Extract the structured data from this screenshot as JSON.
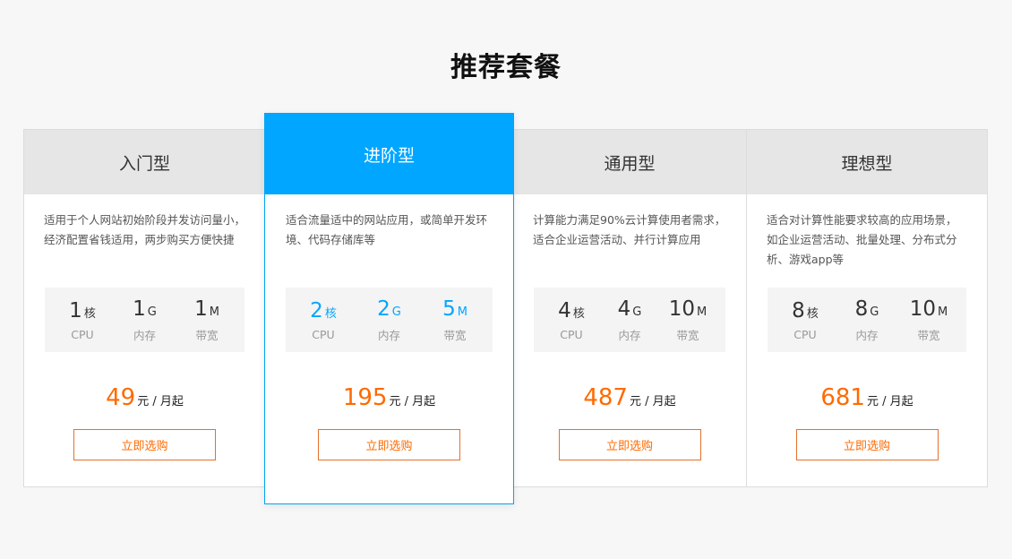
{
  "section_title": "推荐套餐",
  "plans": [
    {
      "name": "入门型",
      "desc": "适用于个人网站初始阶段并发访问量小，经济配置省钱适用，两步购买方便快捷",
      "specs": [
        {
          "num": "1",
          "unit": "核",
          "label": "CPU"
        },
        {
          "num": "1",
          "unit": "G",
          "label": "内存"
        },
        {
          "num": "1",
          "unit": "M",
          "label": "带宽"
        }
      ],
      "price": "49",
      "price_suffix": "元 / 月起",
      "buy_label": "立即选购"
    },
    {
      "name": "进阶型",
      "desc": "适合流量适中的网站应用，或简单开发环境、代码存储库等",
      "specs": [
        {
          "num": "2",
          "unit": "核",
          "label": "CPU"
        },
        {
          "num": "2",
          "unit": "G",
          "label": "内存"
        },
        {
          "num": "5",
          "unit": "M",
          "label": "带宽"
        }
      ],
      "price": "195",
      "price_suffix": "元 / 月起",
      "buy_label": "立即选购"
    },
    {
      "name": "通用型",
      "desc": "计算能力满足90%云计算使用者需求，适合企业运营活动、并行计算应用",
      "specs": [
        {
          "num": "4",
          "unit": "核",
          "label": "CPU"
        },
        {
          "num": "4",
          "unit": "G",
          "label": "内存"
        },
        {
          "num": "10",
          "unit": "M",
          "label": "带宽"
        }
      ],
      "price": "487",
      "price_suffix": "元 / 月起",
      "buy_label": "立即选购"
    },
    {
      "name": "理想型",
      "desc": "适合对计算性能要求较高的应用场景，如企业运营活动、批量处理、分布式分析、游戏app等",
      "specs": [
        {
          "num": "8",
          "unit": "核",
          "label": "CPU"
        },
        {
          "num": "8",
          "unit": "G",
          "label": "内存"
        },
        {
          "num": "10",
          "unit": "M",
          "label": "带宽"
        }
      ],
      "price": "681",
      "price_suffix": "元 / 月起",
      "buy_label": "立即选购"
    }
  ],
  "colors": {
    "accent": "#00a6ff",
    "price": "#ff6a00",
    "header_bg": "#e6e6e6"
  }
}
